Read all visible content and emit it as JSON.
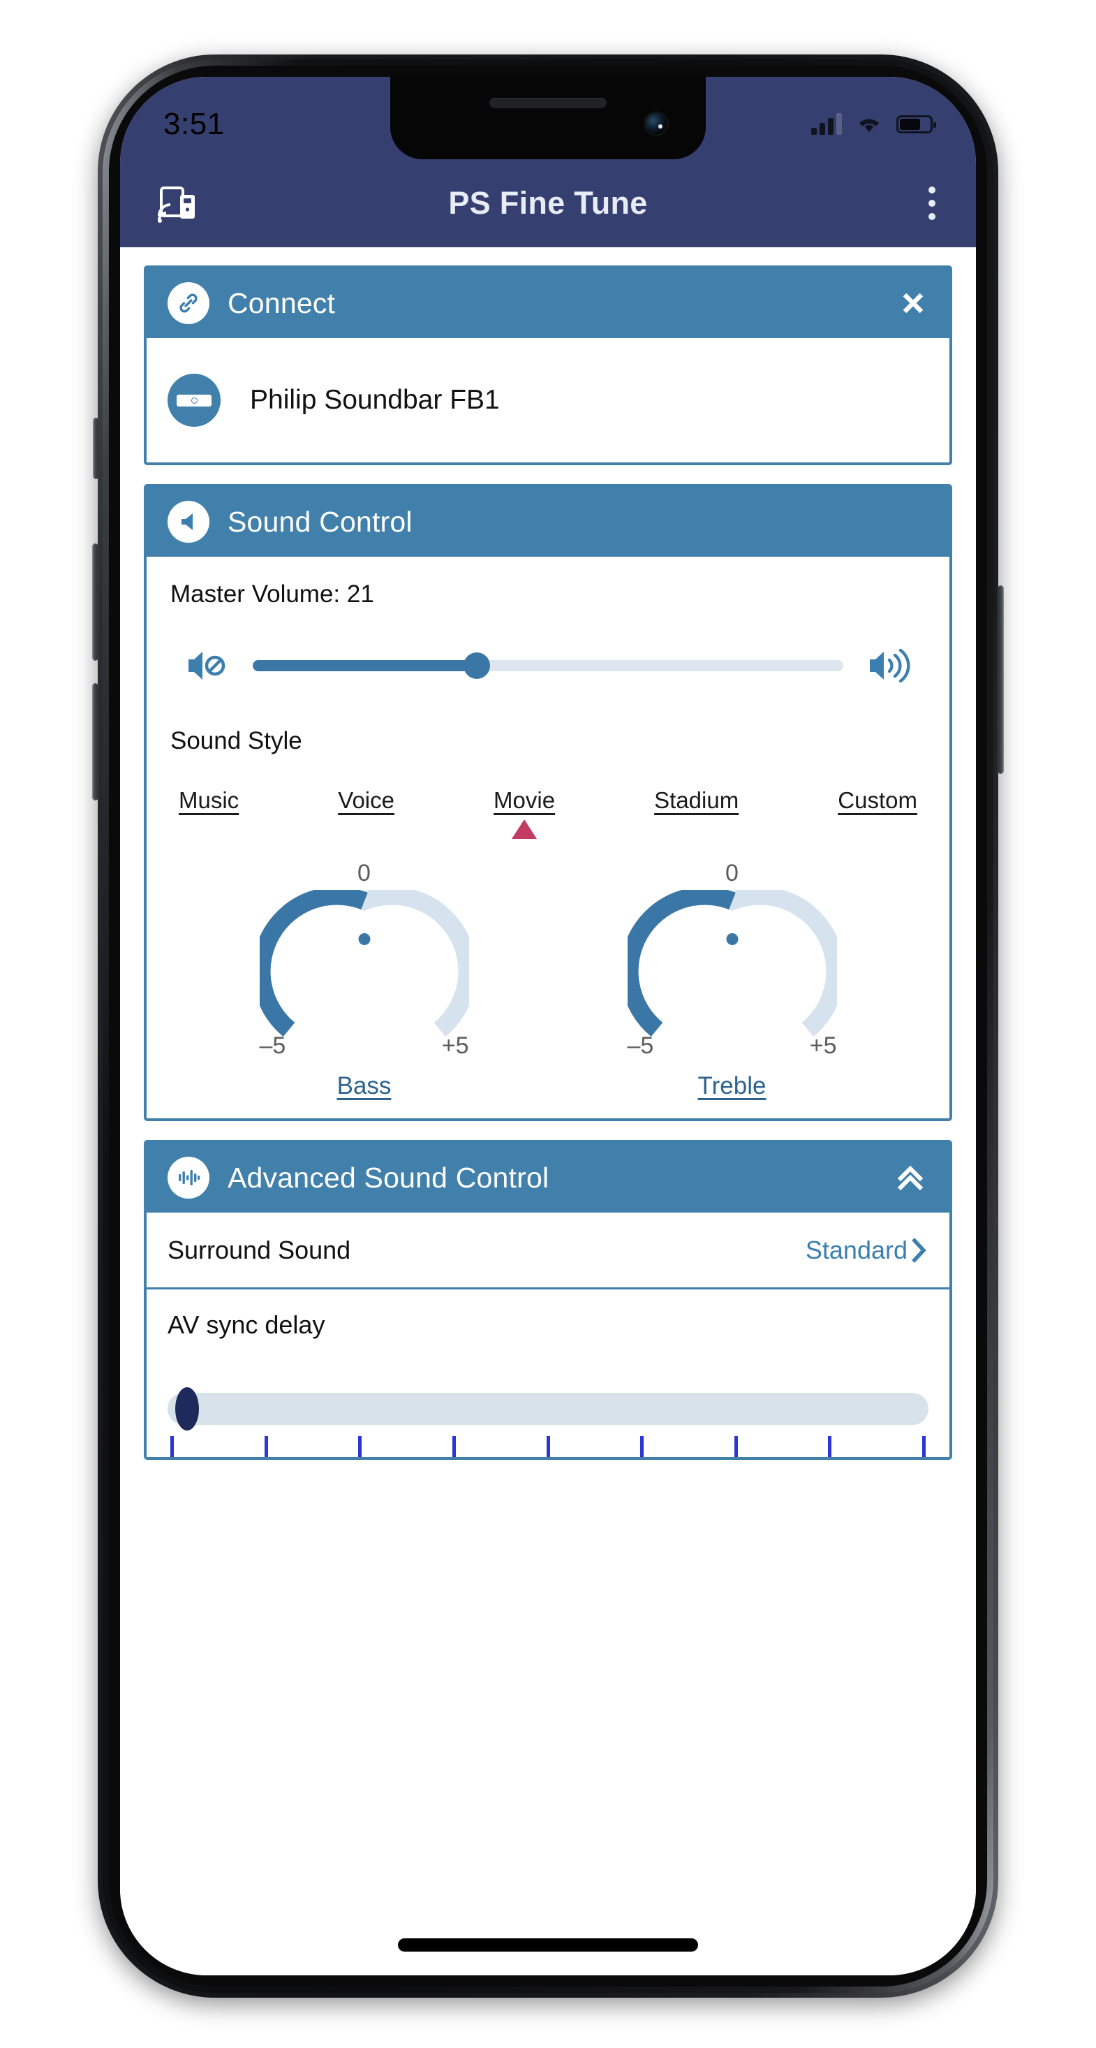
{
  "status_bar": {
    "time": "3:51",
    "signal_icon": "signal-bars-icon",
    "wifi_icon": "wifi-icon",
    "battery_icon": "battery-icon",
    "battery_level_percent": 70
  },
  "app_bar": {
    "title": "PS Fine Tune",
    "left_icon": "cast-device-icon",
    "right_icon": "overflow-menu-icon",
    "background_color": "#364070"
  },
  "theme": {
    "accent_blue": "#4180ab",
    "slider_blue": "#3b77a6",
    "marker_crimson": "#c23b63",
    "track_grey": "#dde6ee",
    "navy": "#1f2a5c"
  },
  "connect_card": {
    "title": "Connect",
    "icon": "link-icon",
    "close_label": "✕",
    "device": {
      "name": "Philip Soundbar FB1",
      "icon": "soundbar-icon"
    }
  },
  "sound_control_card": {
    "title": "Sound Control",
    "icon": "speaker-icon",
    "master_volume_label": "Master Volume: 21",
    "master_volume_value": 21,
    "volume_percent": 38,
    "mute_icon": "volume-mute-icon",
    "volume_up_icon": "volume-high-icon",
    "sound_style_label": "Sound Style",
    "styles": [
      "Music",
      "Voice",
      "Movie",
      "Stadium",
      "Custom"
    ],
    "selected_style": "Movie",
    "selected_style_index": 2,
    "knobs": [
      {
        "name": "Bass",
        "value": "0",
        "min_label": "–5",
        "max_label": "+5",
        "min": -5,
        "max": 5
      },
      {
        "name": "Treble",
        "value": "0",
        "min_label": "–5",
        "max_label": "+5",
        "min": -5,
        "max": 5
      }
    ]
  },
  "advanced_card": {
    "title": "Advanced Sound Control",
    "icon": "equalizer-icon",
    "collapse_icon": "chevron-double-up-icon",
    "rows": [
      {
        "label": "Surround Sound",
        "value": "Standard",
        "chevron": "›"
      }
    ],
    "avsync": {
      "label": "AV sync delay",
      "value_percent": 1,
      "tick_count": 9
    }
  }
}
